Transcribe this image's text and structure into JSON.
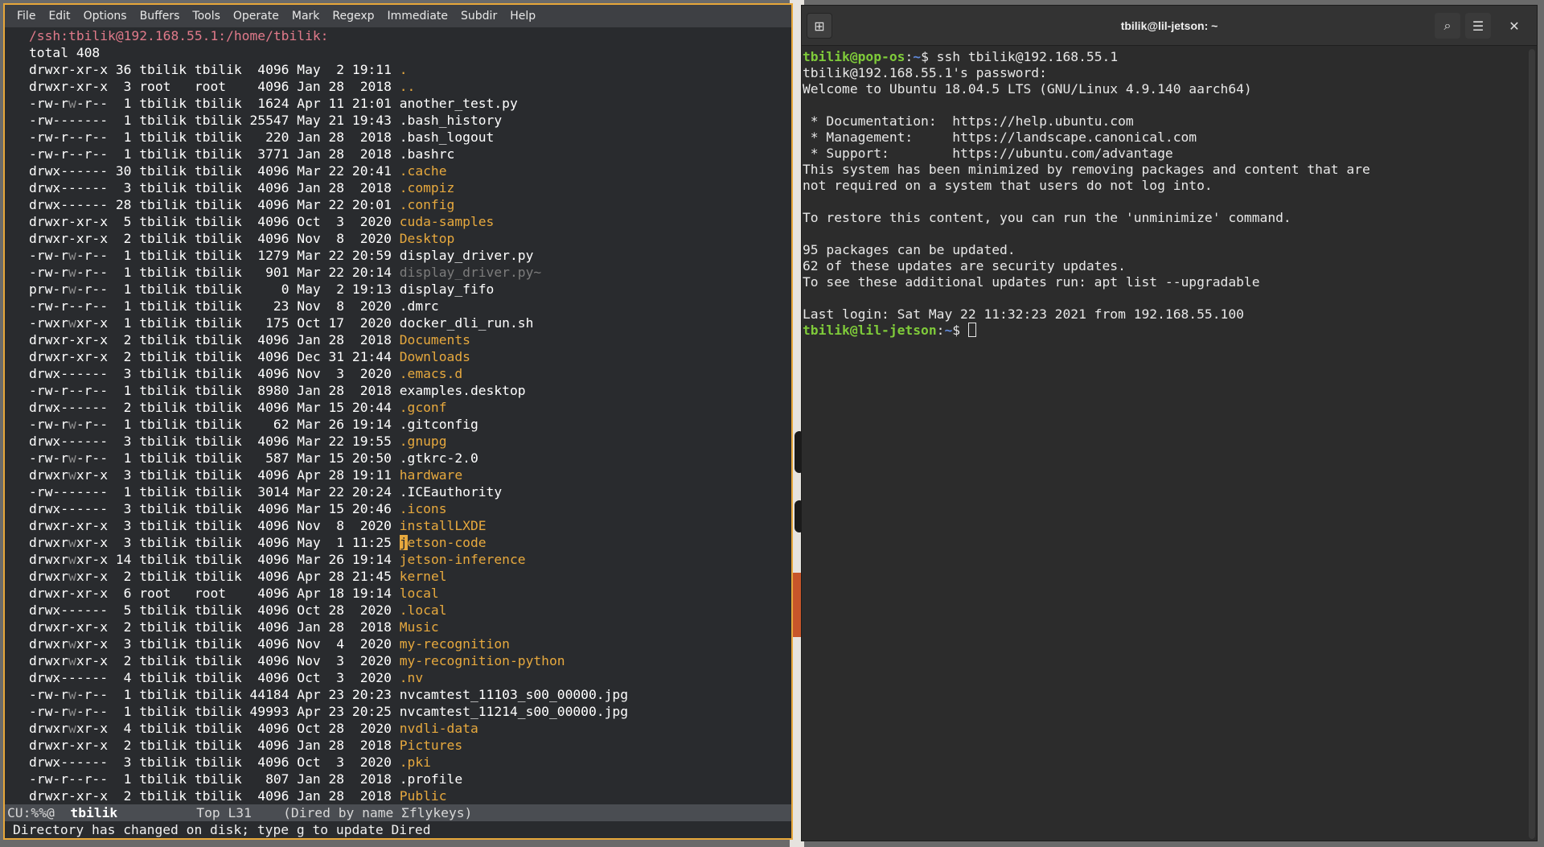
{
  "emacs": {
    "menu": [
      "File",
      "Edit",
      "Options",
      "Buffers",
      "Tools",
      "Operate",
      "Mark",
      "Regexp",
      "Immediate",
      "Subdir",
      "Help"
    ],
    "header": "/ssh:tbilik@192.168.55.1:/home/tbilik:",
    "total": "total 408",
    "entries": [
      {
        "p": "drwxr-xr-x",
        "n": "36",
        "o": "tbilik",
        "g": "tbilik",
        "s": "4096",
        "d": "May  2 19:11",
        "f": ".",
        "t": "dir"
      },
      {
        "p": "drwxr-xr-x",
        "n": " 3",
        "o": "root  ",
        "g": "root  ",
        "s": "4096",
        "d": "Jan 28  2018",
        "f": "..",
        "t": "dir"
      },
      {
        "p": "-rw-rw-r--",
        "n": " 1",
        "o": "tbilik",
        "g": "tbilik",
        "s": "1624",
        "d": "Apr 11 21:01",
        "f": "another_test.py",
        "t": "file"
      },
      {
        "p": "-rw-------",
        "n": " 1",
        "o": "tbilik",
        "g": "tbilik",
        "s": "25547",
        "d": "May 21 19:43",
        "f": ".bash_history",
        "t": "file"
      },
      {
        "p": "-rw-r--r--",
        "n": " 1",
        "o": "tbilik",
        "g": "tbilik",
        "s": "220",
        "d": "Jan 28  2018",
        "f": ".bash_logout",
        "t": "file"
      },
      {
        "p": "-rw-r--r--",
        "n": " 1",
        "o": "tbilik",
        "g": "tbilik",
        "s": "3771",
        "d": "Jan 28  2018",
        "f": ".bashrc",
        "t": "file"
      },
      {
        "p": "drwx------",
        "n": "30",
        "o": "tbilik",
        "g": "tbilik",
        "s": "4096",
        "d": "Mar 22 20:41",
        "f": ".cache",
        "t": "dir"
      },
      {
        "p": "drwx------",
        "n": " 3",
        "o": "tbilik",
        "g": "tbilik",
        "s": "4096",
        "d": "Jan 28  2018",
        "f": ".compiz",
        "t": "dir"
      },
      {
        "p": "drwx------",
        "n": "28",
        "o": "tbilik",
        "g": "tbilik",
        "s": "4096",
        "d": "Mar 22 20:01",
        "f": ".config",
        "t": "dir"
      },
      {
        "p": "drwxr-xr-x",
        "n": " 5",
        "o": "tbilik",
        "g": "tbilik",
        "s": "4096",
        "d": "Oct  3  2020",
        "f": "cuda-samples",
        "t": "dir"
      },
      {
        "p": "drwxr-xr-x",
        "n": " 2",
        "o": "tbilik",
        "g": "tbilik",
        "s": "4096",
        "d": "Nov  8  2020",
        "f": "Desktop",
        "t": "dir"
      },
      {
        "p": "-rw-rw-r--",
        "n": " 1",
        "o": "tbilik",
        "g": "tbilik",
        "s": "1279",
        "d": "Mar 22 20:59",
        "f": "display_driver.py",
        "t": "file"
      },
      {
        "p": "-rw-rw-r--",
        "n": " 1",
        "o": "tbilik",
        "g": "tbilik",
        "s": "901",
        "d": "Mar 22 20:14",
        "f": "display_driver.py~",
        "t": "backup"
      },
      {
        "p": "prw-rw-r--",
        "n": " 1",
        "o": "tbilik",
        "g": "tbilik",
        "s": "0",
        "d": "May  2 19:13",
        "f": "display_fifo",
        "t": "file"
      },
      {
        "p": "-rw-r--r--",
        "n": " 1",
        "o": "tbilik",
        "g": "tbilik",
        "s": "23",
        "d": "Nov  8  2020",
        "f": ".dmrc",
        "t": "file"
      },
      {
        "p": "-rwxrwxr-x",
        "n": " 1",
        "o": "tbilik",
        "g": "tbilik",
        "s": "175",
        "d": "Oct 17  2020",
        "f": "docker_dli_run.sh",
        "t": "file"
      },
      {
        "p": "drwxr-xr-x",
        "n": " 2",
        "o": "tbilik",
        "g": "tbilik",
        "s": "4096",
        "d": "Jan 28  2018",
        "f": "Documents",
        "t": "dir"
      },
      {
        "p": "drwxr-xr-x",
        "n": " 2",
        "o": "tbilik",
        "g": "tbilik",
        "s": "4096",
        "d": "Dec 31 21:44",
        "f": "Downloads",
        "t": "dir"
      },
      {
        "p": "drwx------",
        "n": " 3",
        "o": "tbilik",
        "g": "tbilik",
        "s": "4096",
        "d": "Nov  3  2020",
        "f": ".emacs.d",
        "t": "dir"
      },
      {
        "p": "-rw-r--r--",
        "n": " 1",
        "o": "tbilik",
        "g": "tbilik",
        "s": "8980",
        "d": "Jan 28  2018",
        "f": "examples.desktop",
        "t": "file"
      },
      {
        "p": "drwx------",
        "n": " 2",
        "o": "tbilik",
        "g": "tbilik",
        "s": "4096",
        "d": "Mar 15 20:44",
        "f": ".gconf",
        "t": "dir"
      },
      {
        "p": "-rw-rw-r--",
        "n": " 1",
        "o": "tbilik",
        "g": "tbilik",
        "s": "62",
        "d": "Mar 26 19:14",
        "f": ".gitconfig",
        "t": "file"
      },
      {
        "p": "drwx------",
        "n": " 3",
        "o": "tbilik",
        "g": "tbilik",
        "s": "4096",
        "d": "Mar 22 19:55",
        "f": ".gnupg",
        "t": "dir"
      },
      {
        "p": "-rw-rw-r--",
        "n": " 1",
        "o": "tbilik",
        "g": "tbilik",
        "s": "587",
        "d": "Mar 15 20:50",
        "f": ".gtkrc-2.0",
        "t": "file"
      },
      {
        "p": "drwxrwxr-x",
        "n": " 3",
        "o": "tbilik",
        "g": "tbilik",
        "s": "4096",
        "d": "Apr 28 19:11",
        "f": "hardware",
        "t": "dir"
      },
      {
        "p": "-rw-------",
        "n": " 1",
        "o": "tbilik",
        "g": "tbilik",
        "s": "3014",
        "d": "Mar 22 20:24",
        "f": ".ICEauthority",
        "t": "file"
      },
      {
        "p": "drwx------",
        "n": " 3",
        "o": "tbilik",
        "g": "tbilik",
        "s": "4096",
        "d": "Mar 15 20:46",
        "f": ".icons",
        "t": "dir"
      },
      {
        "p": "drwxr-xr-x",
        "n": " 3",
        "o": "tbilik",
        "g": "tbilik",
        "s": "4096",
        "d": "Nov  8  2020",
        "f": "installLXDE",
        "t": "dir"
      },
      {
        "p": "drwxrwxr-x",
        "n": " 3",
        "o": "tbilik",
        "g": "tbilik",
        "s": "4096",
        "d": "May  1 11:25",
        "f": "jetson-code",
        "t": "dir",
        "cursor": true
      },
      {
        "p": "drwxrwxr-x",
        "n": "14",
        "o": "tbilik",
        "g": "tbilik",
        "s": "4096",
        "d": "Mar 26 19:14",
        "f": "jetson-inference",
        "t": "dir"
      },
      {
        "p": "drwxrwxr-x",
        "n": " 2",
        "o": "tbilik",
        "g": "tbilik",
        "s": "4096",
        "d": "Apr 28 21:45",
        "f": "kernel",
        "t": "dir"
      },
      {
        "p": "drwxr-xr-x",
        "n": " 6",
        "o": "root  ",
        "g": "root  ",
        "s": "4096",
        "d": "Apr 18 19:14",
        "f": "local",
        "t": "dir"
      },
      {
        "p": "drwx------",
        "n": " 5",
        "o": "tbilik",
        "g": "tbilik",
        "s": "4096",
        "d": "Oct 28  2020",
        "f": ".local",
        "t": "dir"
      },
      {
        "p": "drwxr-xr-x",
        "n": " 2",
        "o": "tbilik",
        "g": "tbilik",
        "s": "4096",
        "d": "Jan 28  2018",
        "f": "Music",
        "t": "dir"
      },
      {
        "p": "drwxrwxr-x",
        "n": " 3",
        "o": "tbilik",
        "g": "tbilik",
        "s": "4096",
        "d": "Nov  4  2020",
        "f": "my-recognition",
        "t": "dir"
      },
      {
        "p": "drwxrwxr-x",
        "n": " 2",
        "o": "tbilik",
        "g": "tbilik",
        "s": "4096",
        "d": "Nov  3  2020",
        "f": "my-recognition-python",
        "t": "dir"
      },
      {
        "p": "drwx------",
        "n": " 4",
        "o": "tbilik",
        "g": "tbilik",
        "s": "4096",
        "d": "Oct  3  2020",
        "f": ".nv",
        "t": "dir"
      },
      {
        "p": "-rw-rw-r--",
        "n": " 1",
        "o": "tbilik",
        "g": "tbilik",
        "s": "44184",
        "d": "Apr 23 20:23",
        "f": "nvcamtest_11103_s00_00000.jpg",
        "t": "file"
      },
      {
        "p": "-rw-rw-r--",
        "n": " 1",
        "o": "tbilik",
        "g": "tbilik",
        "s": "49993",
        "d": "Apr 23 20:25",
        "f": "nvcamtest_11214_s00_00000.jpg",
        "t": "file"
      },
      {
        "p": "drwxrwxr-x",
        "n": " 4",
        "o": "tbilik",
        "g": "tbilik",
        "s": "4096",
        "d": "Oct 28  2020",
        "f": "nvdli-data",
        "t": "dir"
      },
      {
        "p": "drwxr-xr-x",
        "n": " 2",
        "o": "tbilik",
        "g": "tbilik",
        "s": "4096",
        "d": "Jan 28  2018",
        "f": "Pictures",
        "t": "dir"
      },
      {
        "p": "drwx------",
        "n": " 3",
        "o": "tbilik",
        "g": "tbilik",
        "s": "4096",
        "d": "Oct  3  2020",
        "f": ".pki",
        "t": "dir"
      },
      {
        "p": "-rw-r--r--",
        "n": " 1",
        "o": "tbilik",
        "g": "tbilik",
        "s": "807",
        "d": "Jan 28  2018",
        "f": ".profile",
        "t": "file"
      },
      {
        "p": "drwxr-xr-x",
        "n": " 2",
        "o": "tbilik",
        "g": "tbilik",
        "s": "4096",
        "d": "Jan 28  2018",
        "f": "Public",
        "t": "dir"
      }
    ],
    "modeline": {
      "prefix": "CU:%%@  ",
      "bufname": "tbilik",
      "rest": "          Top L31    (Dired by name Σflykeys)"
    },
    "echo": "Directory has changed on disk; type g to update Dired"
  },
  "terminal": {
    "title": "tbilik@lil-jetson: ~",
    "buttons": {
      "new_tab": "⊞",
      "search": "⌕",
      "menu": "☰",
      "close": "✕"
    },
    "lines": [
      {
        "segs": [
          [
            "g",
            "tbilik@pop-os"
          ],
          [
            "",
            ":"
          ],
          [
            "b",
            "~"
          ],
          [
            "",
            "$ ssh tbilik@192.168.55.1"
          ]
        ]
      },
      {
        "segs": [
          [
            "",
            "tbilik@192.168.55.1's password:"
          ]
        ]
      },
      {
        "segs": [
          [
            "",
            "Welcome to Ubuntu 18.04.5 LTS (GNU/Linux 4.9.140 aarch64)"
          ]
        ]
      },
      {
        "segs": [
          [
            "",
            ""
          ]
        ]
      },
      {
        "segs": [
          [
            "",
            " * Documentation:  https://help.ubuntu.com"
          ]
        ]
      },
      {
        "segs": [
          [
            "",
            " * Management:     https://landscape.canonical.com"
          ]
        ]
      },
      {
        "segs": [
          [
            "",
            " * Support:        https://ubuntu.com/advantage"
          ]
        ]
      },
      {
        "segs": [
          [
            "",
            "This system has been minimized by removing packages and content that are"
          ]
        ]
      },
      {
        "segs": [
          [
            "",
            "not required on a system that users do not log into."
          ]
        ]
      },
      {
        "segs": [
          [
            "",
            ""
          ]
        ]
      },
      {
        "segs": [
          [
            "",
            "To restore this content, you can run the 'unminimize' command."
          ]
        ]
      },
      {
        "segs": [
          [
            "",
            ""
          ]
        ]
      },
      {
        "segs": [
          [
            "",
            "95 packages can be updated."
          ]
        ]
      },
      {
        "segs": [
          [
            "",
            "62 of these updates are security updates."
          ]
        ]
      },
      {
        "segs": [
          [
            "",
            "To see these additional updates run: apt list --upgradable"
          ]
        ]
      },
      {
        "segs": [
          [
            "",
            ""
          ]
        ]
      },
      {
        "segs": [
          [
            "",
            "Last login: Sat May 22 11:32:23 2021 from 192.168.55.100"
          ]
        ]
      },
      {
        "segs": [
          [
            "g",
            "tbilik@lil-jetson"
          ],
          [
            "",
            ":"
          ],
          [
            "b",
            "~"
          ],
          [
            "",
            "$ "
          ]
        ],
        "cursor": true
      }
    ]
  }
}
